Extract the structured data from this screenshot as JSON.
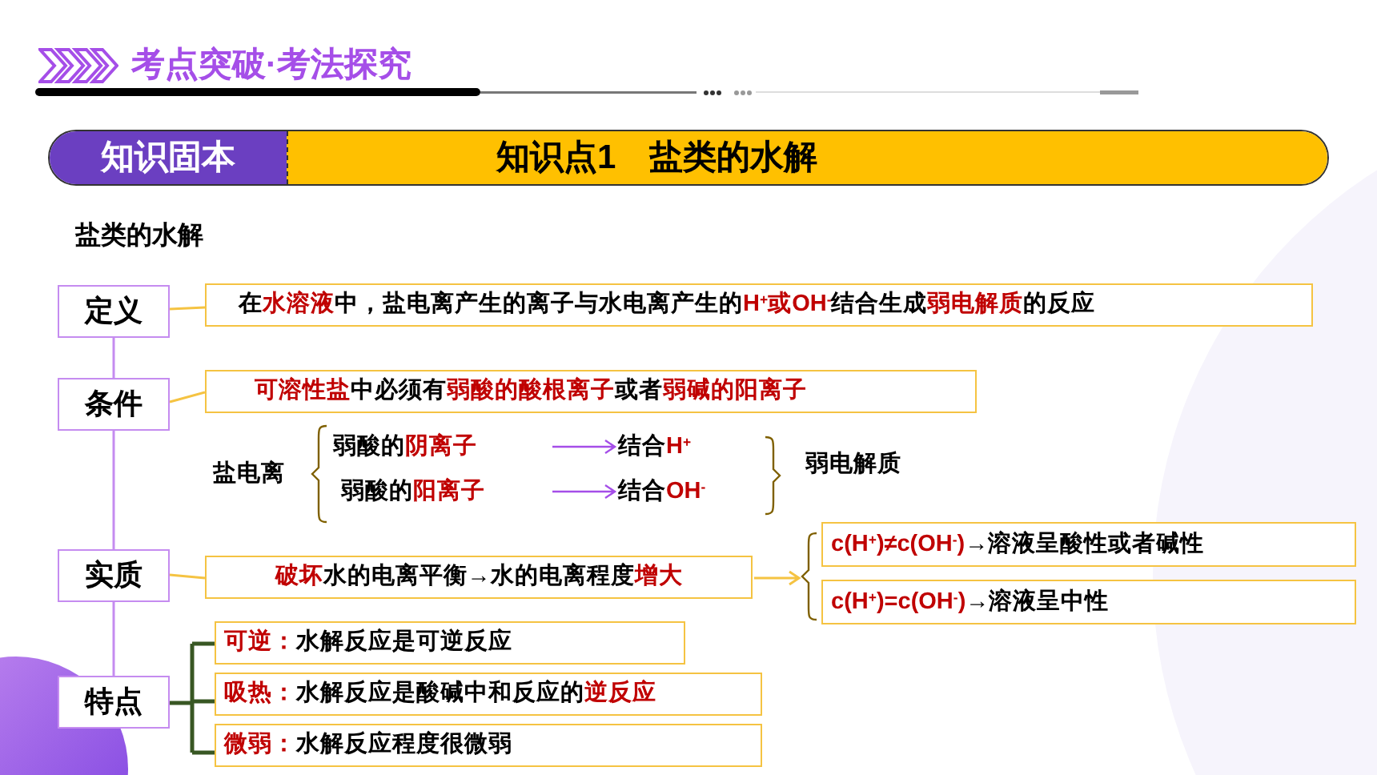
{
  "header": {
    "title": "考点突破·考法探究"
  },
  "banner": {
    "tag": "知识固本",
    "title": "知识点1　盐类的水解"
  },
  "section_title": "盐类的水解",
  "definition": {
    "label": "定义",
    "text": [
      {
        "text": "在",
        "highlight": false
      },
      {
        "text": "水溶液",
        "highlight": true
      },
      {
        "text": "中，盐电离产生的离子与水电离产生的",
        "highlight": false
      },
      {
        "text": "H$^{+}$或OH$^{-}$",
        "highlight": true
      },
      {
        "text": "结合生成",
        "highlight": false
      },
      {
        "text": "弱电解质",
        "highlight": true
      },
      {
        "text": "的反应",
        "highlight": false
      }
    ]
  },
  "condition": {
    "label": "条件",
    "text": [
      {
        "text": "可溶性盐",
        "highlight": true
      },
      {
        "text": "中必须有",
        "highlight": false
      },
      {
        "text": "弱酸的酸根离子",
        "highlight": true
      },
      {
        "text": "或者",
        "highlight": false
      },
      {
        "text": "弱碱的阳离子",
        "highlight": true
      }
    ],
    "ionization": {
      "label": "盐电离",
      "ions": [
        {
          "ion": [
            {
              "text": "弱酸的",
              "highlight": false
            },
            {
              "text": "阴离子",
              "highlight": true
            }
          ],
          "result": [
            {
              "text": "结合",
              "highlight": false
            },
            {
              "text": "H$^{+}$",
              "highlight": true
            }
          ]
        },
        {
          "ion": [
            {
              "text": "弱酸的",
              "highlight": false
            },
            {
              "text": "阳离子",
              "highlight": true
            }
          ],
          "result": [
            {
              "text": "结合",
              "highlight": false
            },
            {
              "text": "OH$^{-}$",
              "highlight": true
            }
          ]
        }
      ],
      "product": "弱电解质"
    }
  },
  "essence": {
    "label": "实质",
    "text": [
      {
        "text": "破坏",
        "highlight": true
      },
      {
        "text": "水的电离平衡→水的电离程度",
        "highlight": false
      },
      {
        "text": "增大",
        "highlight": true
      }
    ],
    "outcomes": [
      [
        {
          "text": "c(H$^{+}$)≠c(OH$^{-}$)",
          "highlight": true
        },
        {
          "text": "→溶液呈酸性或者碱性",
          "highlight": false
        }
      ],
      [
        {
          "text": "c(H$^{+}$)=c(OH$^{-}$)",
          "highlight": true
        },
        {
          "text": "→溶液呈中性",
          "highlight": false
        }
      ]
    ]
  },
  "features": {
    "label": "特点",
    "items": [
      [
        {
          "text": "可逆：",
          "highlight": true
        },
        {
          "text": "水解反应是可逆反应",
          "highlight": false
        }
      ],
      [
        {
          "text": "吸热：",
          "highlight": true
        },
        {
          "text": "水解反应是酸碱中和反应的",
          "highlight": false
        },
        {
          "text": "逆反应",
          "highlight": true
        }
      ],
      [
        {
          "text": "微弱：",
          "highlight": true
        },
        {
          "text": "水解反应程度很微弱",
          "highlight": false
        }
      ]
    ]
  }
}
